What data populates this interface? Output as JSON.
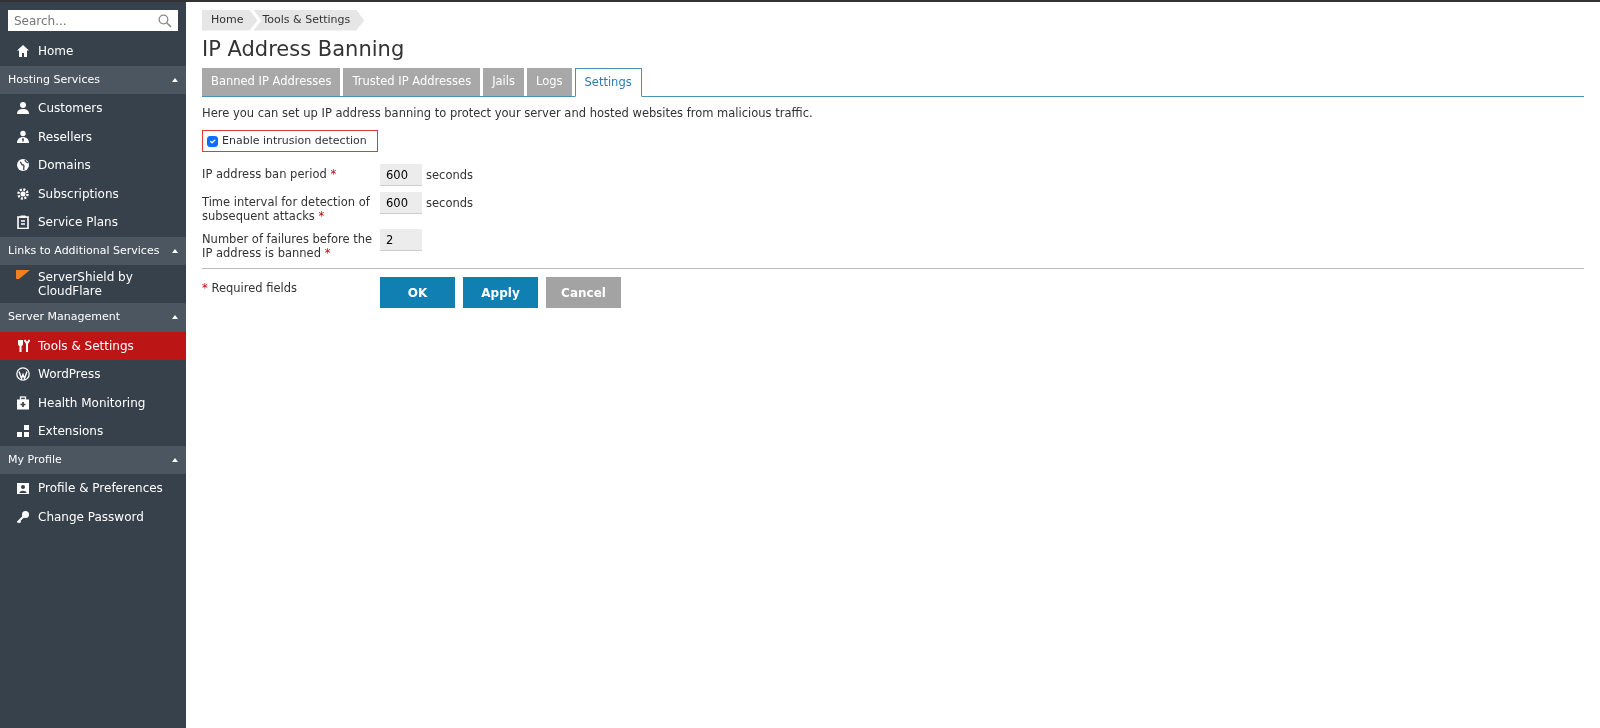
{
  "sidebar": {
    "search": {
      "placeholder": "Search..."
    },
    "items": [
      {
        "kind": "item",
        "label": "Home",
        "selected": false
      },
      {
        "kind": "section",
        "label": "Hosting Services",
        "expanded": true
      },
      {
        "kind": "item",
        "label": "Customers",
        "selected": false
      },
      {
        "kind": "item",
        "label": "Resellers",
        "selected": false
      },
      {
        "kind": "item",
        "label": "Domains",
        "selected": false
      },
      {
        "kind": "item",
        "label": "Subscriptions",
        "selected": false
      },
      {
        "kind": "item",
        "label": "Service Plans",
        "selected": false
      },
      {
        "kind": "section",
        "label": "Links to Additional Services",
        "expanded": true
      },
      {
        "kind": "item",
        "label": "ServerShield by CloudFlare",
        "selected": false
      },
      {
        "kind": "section",
        "label": "Server Management",
        "expanded": true
      },
      {
        "kind": "item",
        "label": "Tools & Settings",
        "selected": true
      },
      {
        "kind": "item",
        "label": "WordPress",
        "selected": false
      },
      {
        "kind": "item",
        "label": "Health Monitoring",
        "selected": false
      },
      {
        "kind": "item",
        "label": "Extensions",
        "selected": false
      },
      {
        "kind": "section",
        "label": "My Profile",
        "expanded": true
      },
      {
        "kind": "item",
        "label": "Profile & Preferences",
        "selected": false
      },
      {
        "kind": "item",
        "label": "Change Password",
        "selected": false
      }
    ]
  },
  "breadcrumbs": [
    "Home",
    "Tools & Settings"
  ],
  "title": "IP Address Banning",
  "tabs": [
    {
      "label": "Banned IP Addresses",
      "selected": false
    },
    {
      "label": "Trusted IP Addresses",
      "selected": false
    },
    {
      "label": "Jails",
      "selected": false
    },
    {
      "label": "Logs",
      "selected": false
    },
    {
      "label": "Settings",
      "selected": true
    }
  ],
  "description": "Here you can set up IP address banning to protect your server and hosted websites from malicious traffic.",
  "checkbox": {
    "label": "Enable intrusion detection",
    "checked": true,
    "highlighted": true
  },
  "fields": [
    {
      "label": "IP address ban period",
      "required_mark": "*",
      "value": "600",
      "unit": "seconds"
    },
    {
      "label": "Time interval for detection of subsequent attacks",
      "required_mark": "*",
      "value": "600",
      "unit": "seconds"
    },
    {
      "label": "Number of failures before the IP address is banned",
      "required_mark": "*",
      "value": "2"
    }
  ],
  "required_note": {
    "mark": "*",
    "text": "Required fields"
  },
  "buttons": [
    {
      "label": "OK",
      "kind": "primary"
    },
    {
      "label": "Apply",
      "kind": "primary"
    },
    {
      "label": "Cancel",
      "kind": "secondary"
    }
  ]
}
